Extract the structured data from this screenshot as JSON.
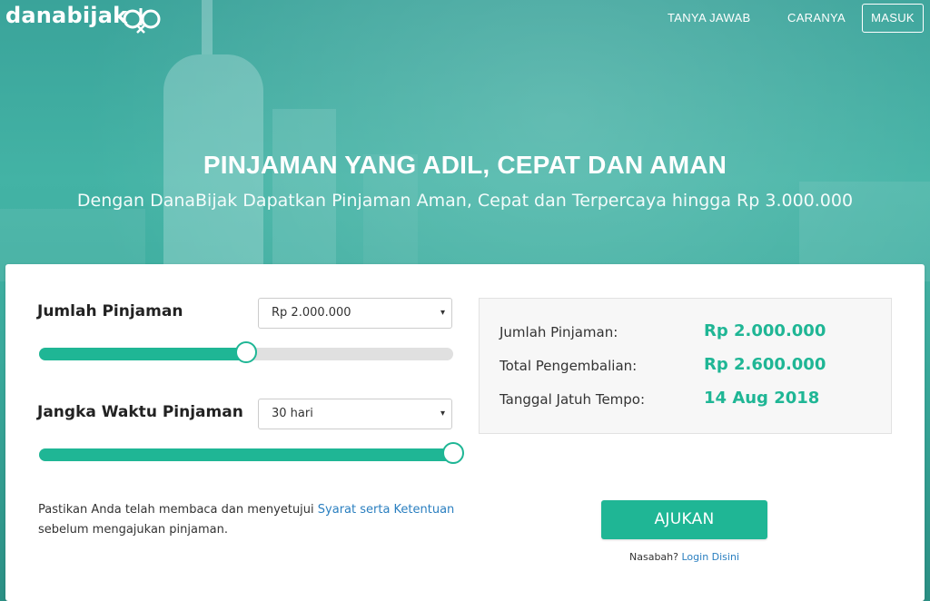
{
  "brand": {
    "name": "danabijak",
    "logo_icon": "db-monogram-icon"
  },
  "nav": {
    "links": [
      {
        "label": "TANYA JAWAB"
      },
      {
        "label": "CARANYA"
      }
    ],
    "login_label": "MASUK"
  },
  "hero": {
    "title": "PINJAMAN YANG ADIL, CEPAT DAN AMAN",
    "subtitle": "Dengan DanaBijak Dapatkan Pinjaman Aman, Cepat dan Terpercaya hingga Rp 3.000.000"
  },
  "form": {
    "amount": {
      "label": "Jumlah Pinjaman",
      "selected": "Rp 2.000.000",
      "slider_fraction": 0.5
    },
    "term": {
      "label": "Jangka Waktu Pinjaman",
      "selected": "30 hari",
      "slider_fraction": 1.0
    }
  },
  "summary": {
    "rows": [
      {
        "label": "Jumlah Pinjaman:",
        "value": "Rp 2.000.000"
      },
      {
        "label": "Total Pengembalian:",
        "value": "Rp 2.600.000"
      },
      {
        "label": "Tanggal Jatuh Tempo:",
        "value": "14 Aug 2018"
      }
    ]
  },
  "notice": {
    "prefix": "Pastikan Anda telah membaca dan menyetujui",
    "link_text": "Syarat serta Ketentuan",
    "suffix": "sebelum mengajukan pinjaman."
  },
  "actions": {
    "submit_label": "AJUKAN",
    "login_prompt": "Nasabah?",
    "login_link": "Login Disini"
  },
  "colors": {
    "accent": "#1fb695",
    "link": "#2a7fc0",
    "hero_bg": "#3aa89a"
  }
}
